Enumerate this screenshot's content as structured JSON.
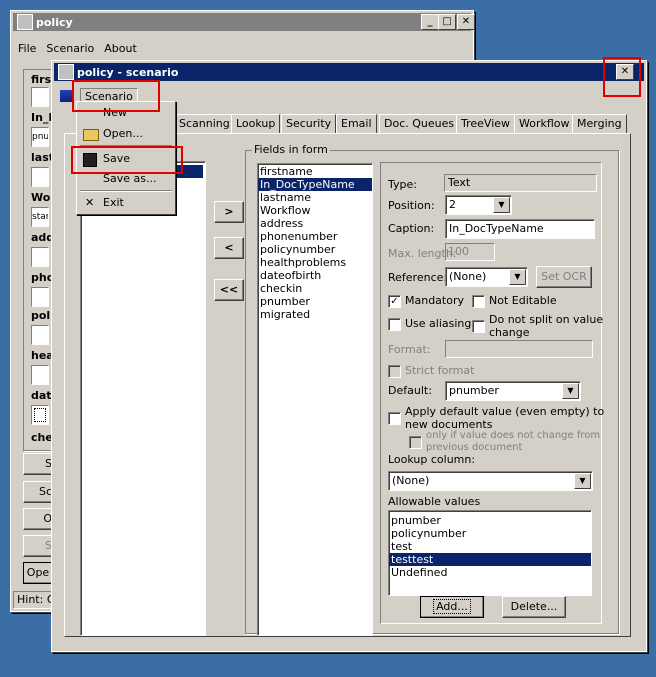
{
  "bg_window": {
    "title": "policy",
    "menu": [
      "File",
      "Scenario",
      "About"
    ],
    "field_labels": [
      "first",
      "In_I",
      "last",
      "Wor",
      "add",
      "pho",
      "poli",
      "hea",
      "date",
      "che"
    ],
    "field_values": {
      "in_i": "pnu",
      "wor": "star"
    },
    "buttons": [
      "S",
      "Sc",
      "O",
      "S",
      "Ope"
    ],
    "hint": "Hint: O"
  },
  "main_window": {
    "title": "policy - scenario",
    "menu_label": "Scenario",
    "tabs": [
      "Scanning",
      "Lookup",
      "Security",
      "Email",
      "Doc. Queues",
      "TreeView",
      "Workflow",
      "Merging"
    ]
  },
  "scenario_menu": {
    "items": [
      {
        "label": "New",
        "icon": ""
      },
      {
        "label": "Open...",
        "icon": "open-folder-icon"
      },
      {
        "label": "Save",
        "icon": "floppy-disk-icon"
      },
      {
        "label": "Save as...",
        "icon": ""
      },
      {
        "label": "Exit",
        "icon": "close-x-icon"
      }
    ]
  },
  "transfer_buttons": [
    ">",
    "<",
    "<<"
  ],
  "fields_in_form": {
    "title": "Fields in form",
    "items": [
      "firstname",
      "In_DocTypeName",
      "lastname",
      "Workflow",
      "address",
      "phonenumber",
      "policynumber",
      "healthproblems",
      "dateofbirth",
      "checkin",
      "pnumber",
      "migrated"
    ],
    "selected_index": 1
  },
  "properties": {
    "type_label": "Type:",
    "type_value": "Text",
    "position_label": "Position:",
    "position_value": "2",
    "caption_label": "Caption:",
    "caption_value": "In_DocTypeName",
    "maxlength_label": "Max. length:",
    "maxlength_value": "100",
    "reference_label": "Reference:",
    "reference_value": "(None)",
    "setocr_label": "Set OCR",
    "mandatory_label": "Mandatory",
    "mandatory_checked": true,
    "not_editable_label": "Not Editable",
    "use_aliasing_label": "Use aliasing",
    "no_split_label_1": "Do not split on value",
    "no_split_label_2": "change",
    "format_label": "Format:",
    "strict_format_label": "Strict format",
    "default_label": "Default:",
    "default_value": "pnumber",
    "apply_default_label_1": "Apply default value (even empty) to",
    "apply_default_label_2": "new documents",
    "only_if_label_1": "only if value does not change from",
    "only_if_label_2": "previous document",
    "lookup_column_label": "Lookup column:",
    "lookup_column_value": "(None)",
    "allowable_label": "Allowable values",
    "allowable_values": [
      "pnumber",
      "policynumber",
      "test",
      "testtest",
      "Undefined"
    ],
    "allowable_selected_index": 3,
    "add_label": "Add...",
    "delete_label": "Delete..."
  },
  "colors": {
    "selection": "#0a246a",
    "desktop": "#3a6ea5",
    "highlight_box": "#e00000"
  }
}
